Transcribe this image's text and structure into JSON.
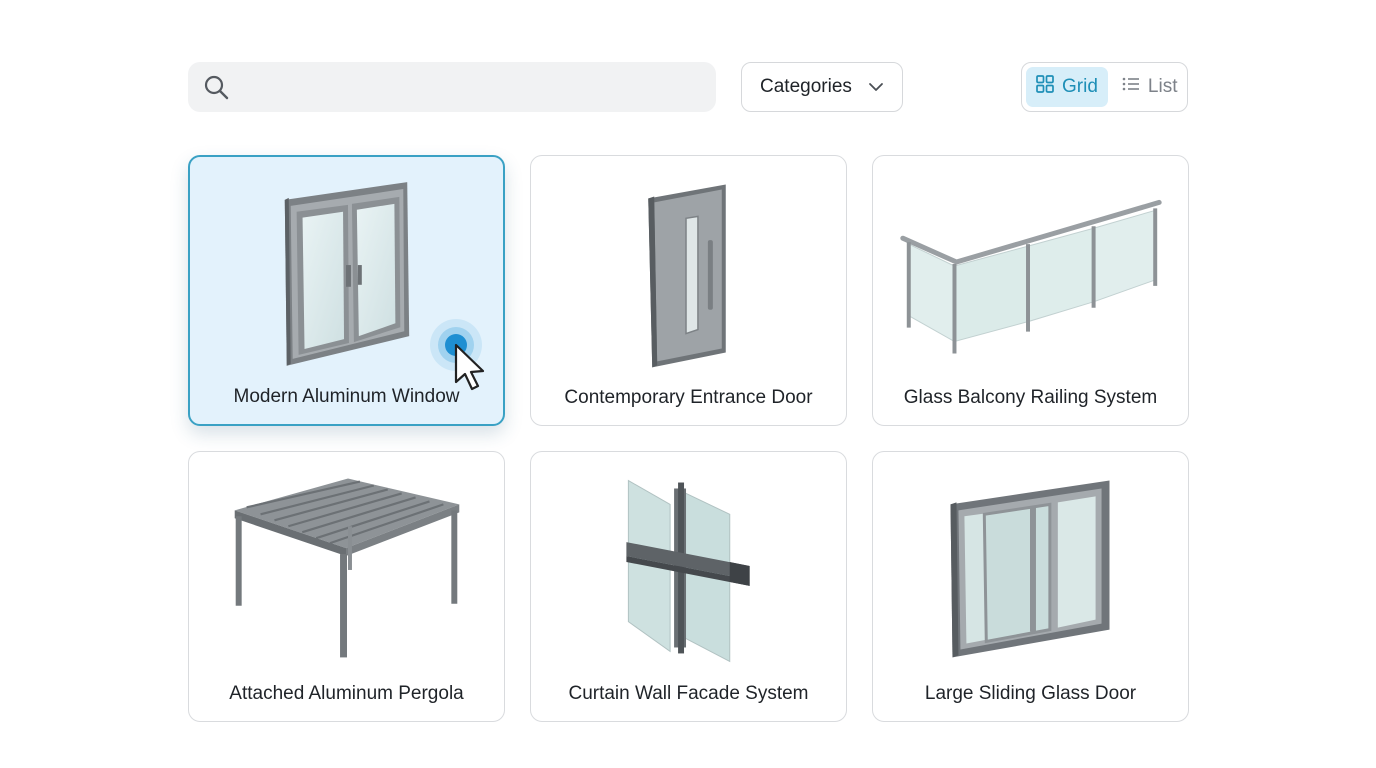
{
  "toolbar": {
    "search": {
      "placeholder": "",
      "value": "",
      "icon": "search-icon"
    },
    "categories": {
      "label": "Categories",
      "icon": "chevron-down-icon"
    },
    "view_toggle": {
      "grid_label": "Grid",
      "list_label": "List",
      "active": "Grid",
      "active_color": "#1e8fb7"
    }
  },
  "products": [
    {
      "name": "Modern Aluminum Window",
      "image": "aluminum-window-image",
      "selected": true
    },
    {
      "name": "Contemporary Entrance Door",
      "image": "entrance-door-image",
      "selected": false
    },
    {
      "name": "Glass Balcony Railing System",
      "image": "balcony-railing-image",
      "selected": false
    },
    {
      "name": "Attached Aluminum Pergola",
      "image": "pergola-image",
      "selected": false
    },
    {
      "name": "Curtain Wall Facade System",
      "image": "curtain-wall-image",
      "selected": false
    },
    {
      "name": "Large Sliding Glass Door",
      "image": "sliding-door-image",
      "selected": false
    }
  ],
  "colors": {
    "selection_border": "#3aa1c4",
    "selection_fill": "#e3f2fc",
    "click_indicator": "#2196d8"
  }
}
